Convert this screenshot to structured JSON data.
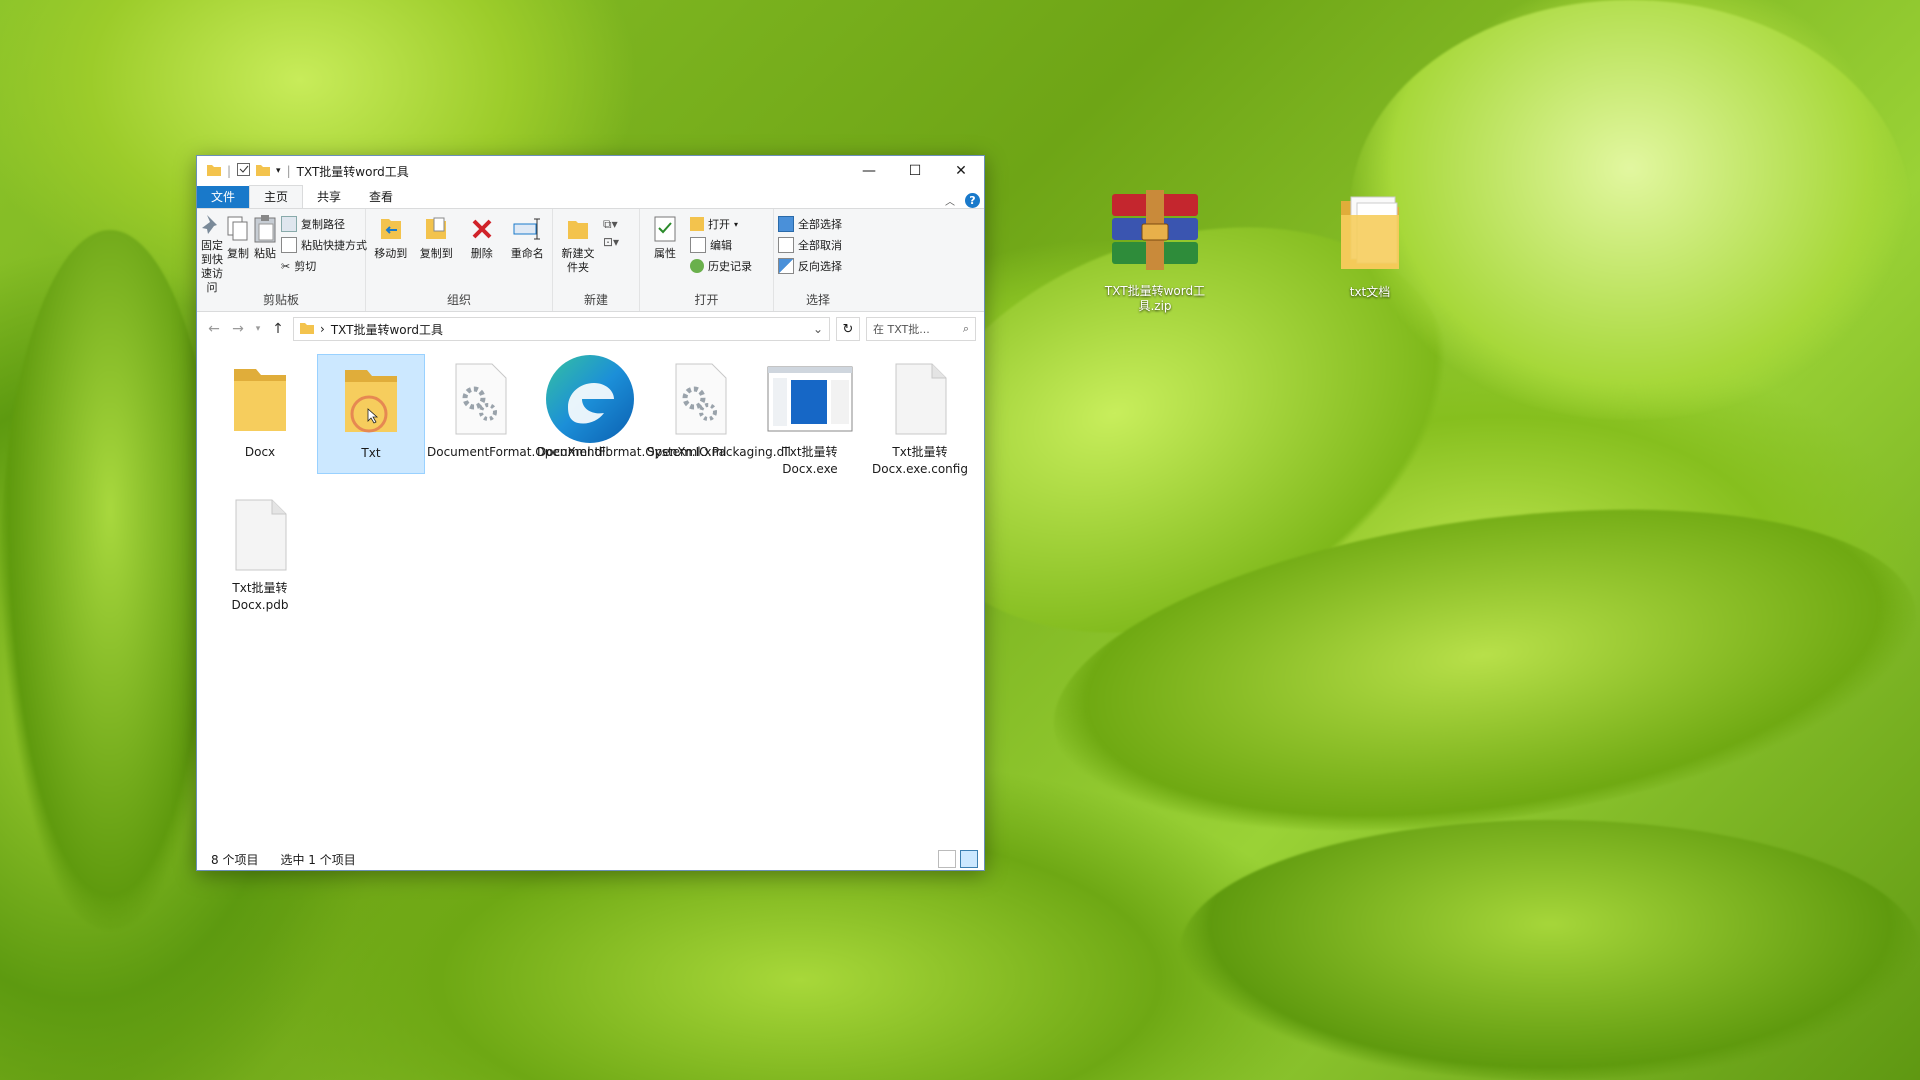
{
  "window": {
    "title": "TXT批量转word工具",
    "tabs": [
      "文件",
      "主页",
      "共享",
      "查看"
    ],
    "help_label": "?"
  },
  "ribbon": {
    "clipboard": {
      "pin_label": "固定到快速访问",
      "copy_label": "复制",
      "paste_label": "粘贴",
      "copy_path_label": "复制路径",
      "paste_shortcut_label": "粘贴快捷方式",
      "cut_label": "剪切",
      "group_label": "剪贴板"
    },
    "organize": {
      "move_to_label": "移动到",
      "copy_to_label": "复制到",
      "delete_label": "删除",
      "rename_label": "重命名",
      "group_label": "组织"
    },
    "new": {
      "new_folder_label": "新建文件夹",
      "group_label": "新建"
    },
    "open": {
      "properties_label": "属性",
      "open_label": "打开",
      "edit_label": "编辑",
      "history_label": "历史记录",
      "group_label": "打开"
    },
    "select": {
      "select_all_label": "全部选择",
      "select_none_label": "全部取消",
      "invert_label": "反向选择",
      "group_label": "选择"
    }
  },
  "address": {
    "path": "TXT批量转word工具",
    "search_placeholder": "在 TXT批..."
  },
  "files": [
    {
      "name": "Docx",
      "type": "folder"
    },
    {
      "name": "Txt",
      "type": "folder",
      "selected": true
    },
    {
      "name": "DocumentFormat.OpenXml.dll",
      "type": "dll"
    },
    {
      "name": "DocumentFormat.OpenXml.xml",
      "type": "edge"
    },
    {
      "name": "System.IO.Packaging.dll",
      "type": "dll"
    },
    {
      "name": "Txt批量转Docx.exe",
      "type": "exe"
    },
    {
      "name": "Txt批量转Docx.exe.config",
      "type": "blank"
    },
    {
      "name": "Txt批量转Docx.pdb",
      "type": "blank"
    }
  ],
  "status": {
    "count": "8 个项目",
    "selected": "选中 1 个项目"
  },
  "desktop": {
    "zip_label": "TXT批量转word工具.zip",
    "folder_label": "txt文档"
  },
  "colors": {
    "accent": "#1979ca",
    "selection": "#cce8ff",
    "folder": "#f3c34d"
  }
}
